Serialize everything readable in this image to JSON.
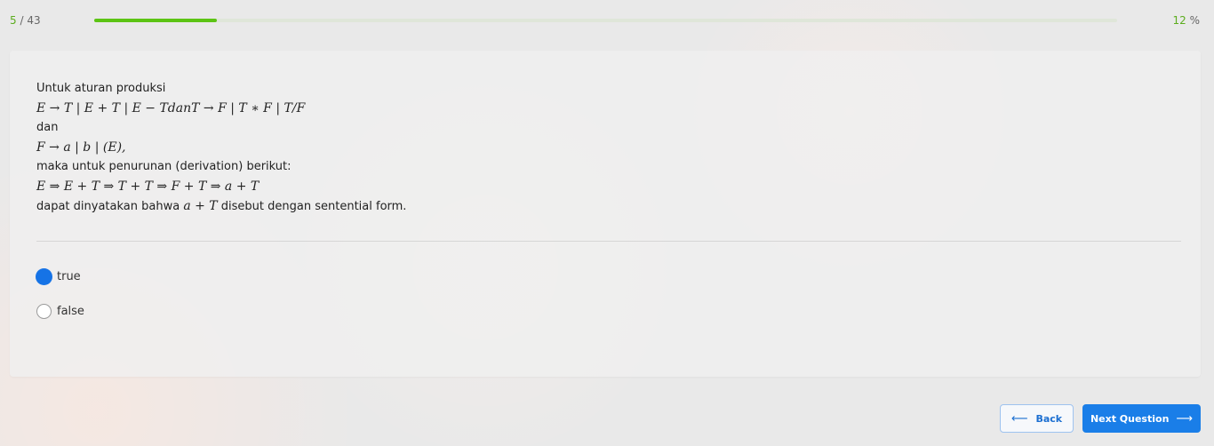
{
  "progress": {
    "current": "5",
    "total": "43",
    "percent_value": "12",
    "percent_symbol": "%",
    "fraction": 0.12
  },
  "question": {
    "intro": "Untuk aturan produksi",
    "rule1": "E → T | E + T | E − TdanT → F | T ∗ F | T/F",
    "dan": "dan",
    "rule2": "F → a | b | (E),",
    "derivation_intro": "maka untuk penurunan (derivation) berikut:",
    "derivation": "E ⇒ E + T ⇒ T + T ⇒ F + T ⇒ a + T",
    "conclusion_pre": "dapat dinyatakan bahwa ",
    "conclusion_math": "a + T",
    "conclusion_post": " disebut dengan sentential form."
  },
  "options": [
    {
      "label": "true",
      "selected": true
    },
    {
      "label": "false",
      "selected": false
    }
  ],
  "buttons": {
    "back_label": "Back",
    "back_icon": "arrow-left-icon",
    "next_label": "Next Question",
    "next_icon": "arrow-right-icon"
  },
  "colors": {
    "accent_green": "#5cc414",
    "primary_blue": "#1a7ee8"
  }
}
